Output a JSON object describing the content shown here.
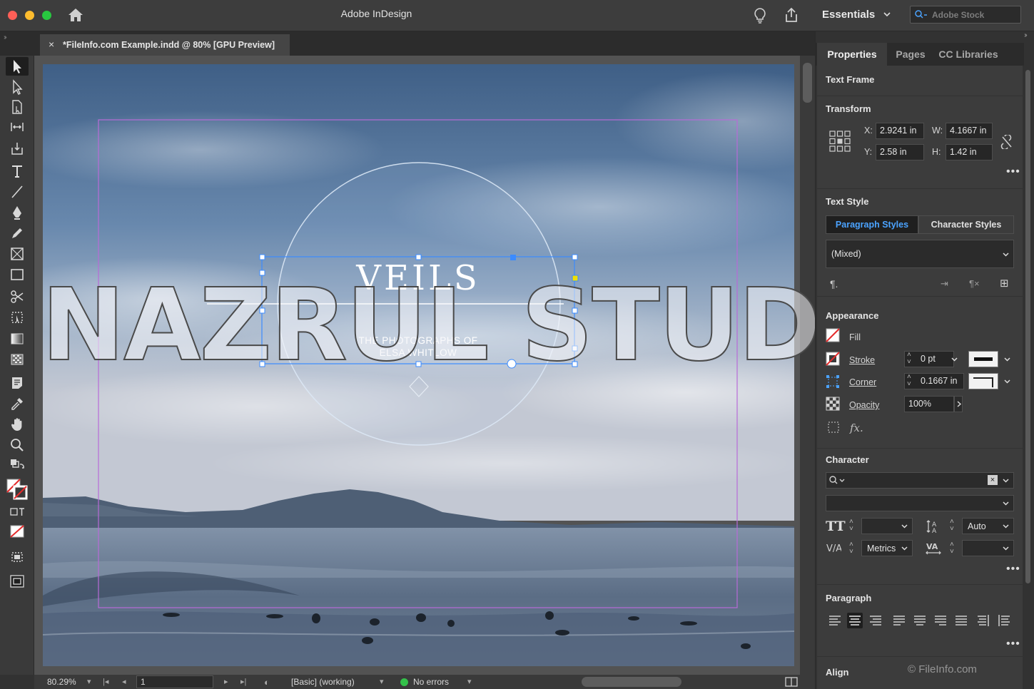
{
  "titlebar": {
    "app_title": "Adobe InDesign",
    "workspace": "Essentials",
    "stock_placeholder": "Adobe Stock"
  },
  "document": {
    "tab_label": "*FileInfo.com Example.indd @ 80% [GPU Preview]",
    "close_glyph": "×"
  },
  "artwork": {
    "title": "VEILS",
    "subtitle_line1": "THE PHOTOGRAPHS OF",
    "subtitle_line2": "ELSA WHITLOW",
    "watermark": "NAZRUL STUDIO"
  },
  "tools": [
    "selection-tool",
    "direct-selection-tool",
    "page-tool",
    "gap-tool",
    "content-collector-tool",
    "type-tool",
    "line-tool",
    "pen-tool",
    "pencil-tool",
    "rectangle-frame-tool",
    "rectangle-tool",
    "scissors-tool",
    "free-transform-tool",
    "gradient-swatch-tool",
    "gradient-feather-tool",
    "note-tool",
    "eyedropper-tool",
    "hand-tool",
    "zoom-tool"
  ],
  "statusbar": {
    "zoom": "80.29%",
    "page": "1",
    "preflight_profile": "[Basic] (working)",
    "errors": "No errors"
  },
  "panel": {
    "tabs": [
      "Properties",
      "Pages",
      "CC Libraries"
    ],
    "object_type": "Text Frame",
    "transform": {
      "heading": "Transform",
      "x_label": "X:",
      "x": "2.9241 in",
      "y_label": "Y:",
      "y": "2.58 in",
      "w_label": "W:",
      "w": "4.1667 in",
      "h_label": "H:",
      "h": "1.42 in"
    },
    "text_style": {
      "heading": "Text Style",
      "paragraph_styles": "Paragraph Styles",
      "character_styles": "Character Styles",
      "style_value": "(Mixed)"
    },
    "appearance": {
      "heading": "Appearance",
      "fill": "Fill",
      "stroke": "Stroke",
      "stroke_weight": "0 pt",
      "corner": "Corner",
      "corner_value": "0.1667 in",
      "opacity": "Opacity",
      "opacity_value": "100%",
      "fx": "fx."
    },
    "character": {
      "heading": "Character",
      "leading": "Auto",
      "kerning": "Metrics"
    },
    "paragraph": {
      "heading": "Paragraph"
    },
    "align": {
      "heading": "Align"
    },
    "credit": "© FileInfo.com"
  },
  "colors": {
    "accent": "#4ba3ff",
    "frame_guide": "#b86bd8",
    "selection": "#3b8bff"
  }
}
